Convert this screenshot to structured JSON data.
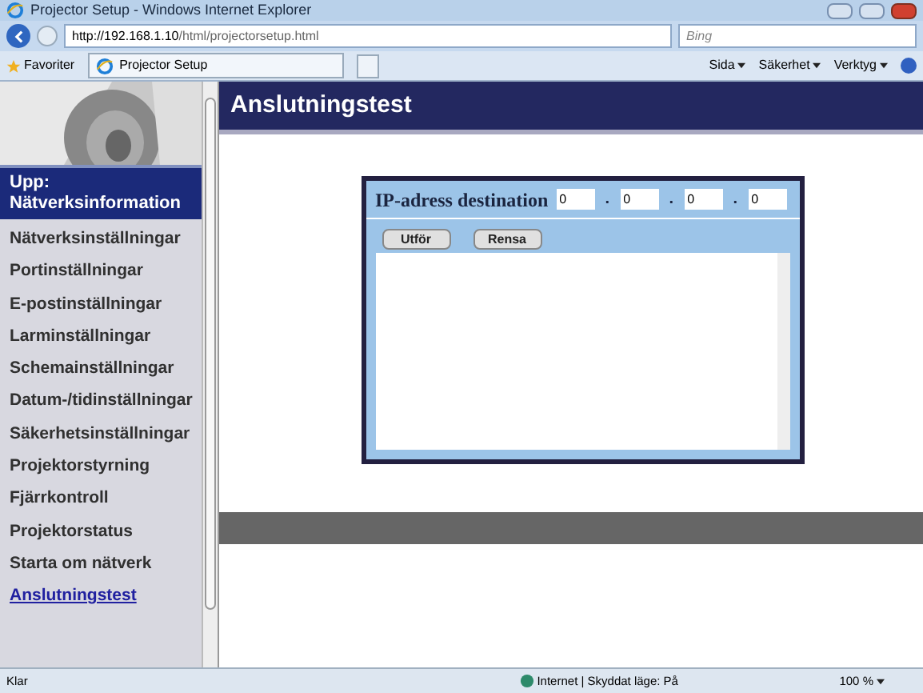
{
  "window": {
    "title": "Projector Setup - Windows Internet Explorer"
  },
  "address_bar": {
    "url_host": "http://192.168.1.10",
    "url_path": "/html/projectorsetup.html"
  },
  "search": {
    "placeholder": "Bing"
  },
  "favorites_bar": {
    "favorites": "Favoriter",
    "tab": "Projector Setup",
    "menus": [
      "Sida",
      "Säkerhet",
      "Verktyg"
    ]
  },
  "sidebar": {
    "up_label": "Upp:",
    "up_target": "Nätverksinformation",
    "items": [
      {
        "label": "Nätverksinställningar",
        "selected": false
      },
      {
        "label": "Portinställningar",
        "selected": false
      },
      {
        "label": "E-postinställningar",
        "selected": false
      },
      {
        "label": "Larminställningar",
        "selected": false
      },
      {
        "label": "Schemainställningar",
        "selected": false
      },
      {
        "label": "Datum-/tidinställningar",
        "selected": false
      },
      {
        "label": "Säkerhetsinställningar",
        "selected": false
      },
      {
        "label": "Projektorstyrning",
        "selected": false
      },
      {
        "label": "Fjärrkontroll",
        "selected": false
      },
      {
        "label": "Projektorstatus",
        "selected": false
      },
      {
        "label": "Starta om nätverk",
        "selected": false
      },
      {
        "label": "Anslutningstest",
        "selected": true
      }
    ]
  },
  "page": {
    "title": "Anslutningstest",
    "ip_label": "IP-adress destination",
    "ip_octets": [
      "0",
      "0",
      "0",
      "0"
    ],
    "ip_separator": ".",
    "buttons": [
      "Utför",
      "Rensa"
    ]
  },
  "status_bar": {
    "status": "Klar",
    "zone": "Internet | Skyddat läge: På",
    "zoom": "100 %"
  }
}
